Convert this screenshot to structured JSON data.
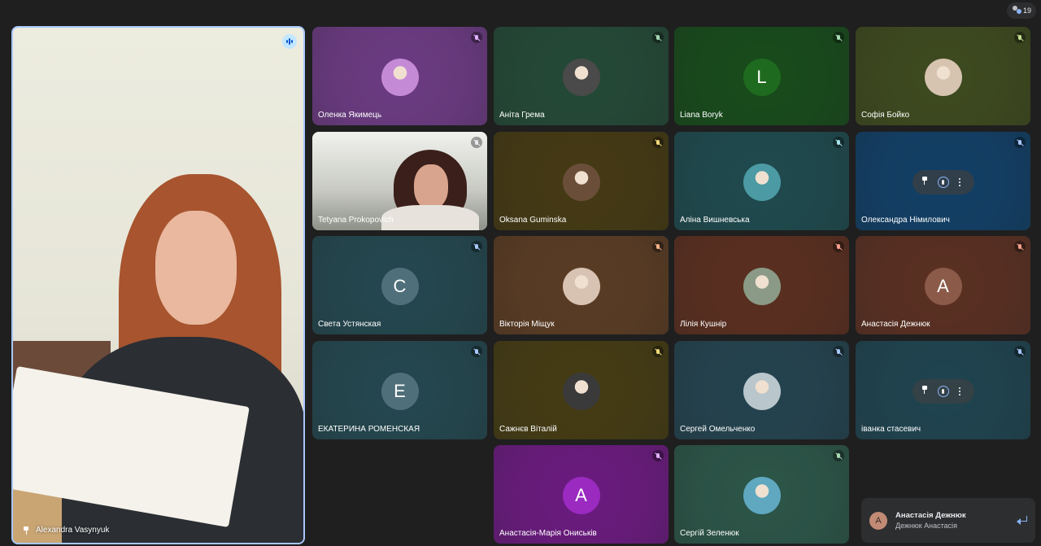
{
  "participant_count": "19",
  "main_speaker": {
    "name": "Alexandra Vasynyuk"
  },
  "tiles": [
    {
      "name": "Оленка Якимець",
      "avatar_type": "image",
      "avatar_color": "#c58ad6",
      "bg": "#6b3b82",
      "mic_color": "#e1b3ff"
    },
    {
      "name": "Аніта Грема",
      "avatar_type": "image",
      "avatar_color": "#4a4a4a",
      "bg": "#244937",
      "mic_color": "#a8dab5"
    },
    {
      "name": "Liana Boryk",
      "avatar_type": "letter",
      "letter": "L",
      "avatar_color": "#1e6a1e",
      "bg": "#184b1c",
      "mic_color": "#a8dab5"
    },
    {
      "name": "Софія Бойко",
      "avatar_type": "image",
      "avatar_color": "#d6c4b0",
      "bg": "#3e4a1f",
      "mic_color": "#c6dc93"
    },
    {
      "name": "Tetyana Prokopovich",
      "avatar_type": "video",
      "bg": "#c7c9c2",
      "mic_color": "#e8eaed"
    },
    {
      "name": "Oksana Guminska",
      "avatar_type": "image",
      "avatar_color": "#6b4e3a",
      "bg": "#453a14",
      "mic_color": "#f1d97a"
    },
    {
      "name": "Аліна Вишневська",
      "avatar_type": "image",
      "avatar_color": "#4b9aa4",
      "bg": "#1f4a4e",
      "mic_color": "#a5e3ea"
    },
    {
      "name": "Олександра Німилович",
      "avatar_type": "hover",
      "bg": "#123f66",
      "mic_color": "#a8c7fa"
    },
    {
      "name": "Света Устянская",
      "avatar_type": "letter",
      "letter": "C",
      "avatar_color": "#4f6f7a",
      "bg": "#24474f",
      "mic_color": "#a8c7fa"
    },
    {
      "name": "Вікторія Міщук",
      "avatar_type": "image",
      "avatar_color": "#d8c2b2",
      "bg": "#5a3c24",
      "mic_color": "#f5b48c"
    },
    {
      "name": "Лілія Кушнір",
      "avatar_type": "image",
      "avatar_color": "#8a9a86",
      "bg": "#5a2f20",
      "mic_color": "#f5a08c"
    },
    {
      "name": "Анастасія Дежнюк",
      "avatar_type": "letter",
      "letter": "А",
      "avatar_color": "#8b5a48",
      "bg": "#5a3022",
      "mic_color": "#f5a08c"
    },
    {
      "name": "ЕКАТЕРИНА РОМЕНСКАЯ",
      "avatar_type": "letter",
      "letter": "E",
      "avatar_color": "#4f6f7a",
      "bg": "#24474f",
      "mic_color": "#a8c7fa"
    },
    {
      "name": "Сажнєв Віталій",
      "avatar_type": "image",
      "avatar_color": "#3a3a3a",
      "bg": "#453c14",
      "mic_color": "#f1d97a"
    },
    {
      "name": "Сергей Омельченко",
      "avatar_type": "image",
      "avatar_color": "#b9c6cc",
      "bg": "#24434f",
      "mic_color": "#a8c7fa"
    },
    {
      "name": "іванка стасевич",
      "avatar_type": "hover",
      "bg": "#1f4450",
      "mic_color": "#a8c7fa"
    },
    {
      "name": "Анастасія-Марія Ониськів",
      "avatar_type": "letter",
      "letter": "А",
      "avatar_color": "#9a2ac0",
      "bg": "#6a1b7e",
      "mic_color": "#e1b3ff"
    },
    {
      "name": "Сергій Зеленюк",
      "avatar_type": "image",
      "avatar_color": "#5fa8c0",
      "bg": "#2c5548",
      "mic_color": "#a8dab5"
    }
  ],
  "toast": {
    "avatar_letter": "А",
    "title": "Анастасія Дежнюк",
    "subtitle": "Дежнюк Анастасія"
  }
}
